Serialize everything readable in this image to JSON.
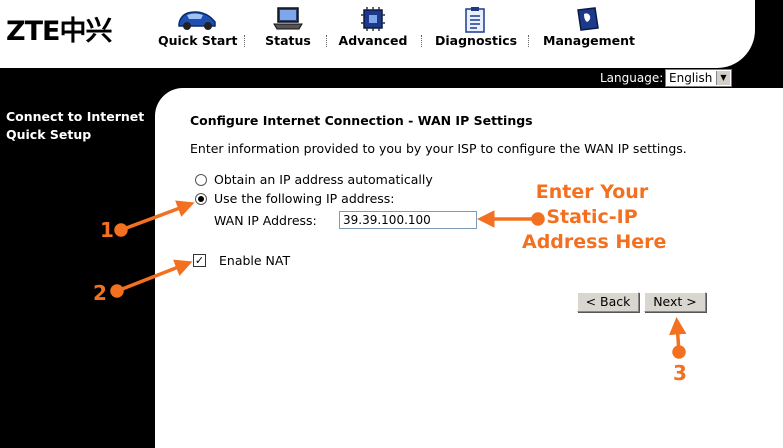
{
  "header": {
    "logo": "ZTE中兴",
    "nav": [
      {
        "label": "Quick Start",
        "icon": "car-icon"
      },
      {
        "label": "Status",
        "icon": "laptop-icon"
      },
      {
        "label": "Advanced",
        "icon": "chip-icon"
      },
      {
        "label": "Diagnostics",
        "icon": "clipboard-icon"
      },
      {
        "label": "Management",
        "icon": "book-icon"
      }
    ],
    "language_label": "Language:",
    "language_value": "English"
  },
  "sidebar": {
    "line1": "Connect to Internet",
    "line2": "Quick Setup"
  },
  "main": {
    "title": "Configure Internet Connection - WAN IP Settings",
    "description": "Enter information provided to you by your ISP to configure the WAN IP settings.",
    "option_auto": "Obtain an IP address automatically",
    "option_manual": "Use the following IP address:",
    "wan_ip_label": "WAN IP Address:",
    "wan_ip_value": "39.39.100.100",
    "enable_nat_label": "Enable NAT",
    "back_button": "< Back",
    "next_button": "Next >"
  },
  "annotations": {
    "step1": "1",
    "step2": "2",
    "step3": "3",
    "callout_line1": "Enter Your",
    "callout_line2": "Static-IP",
    "callout_line3": "Address Here",
    "color": "#f37021"
  }
}
